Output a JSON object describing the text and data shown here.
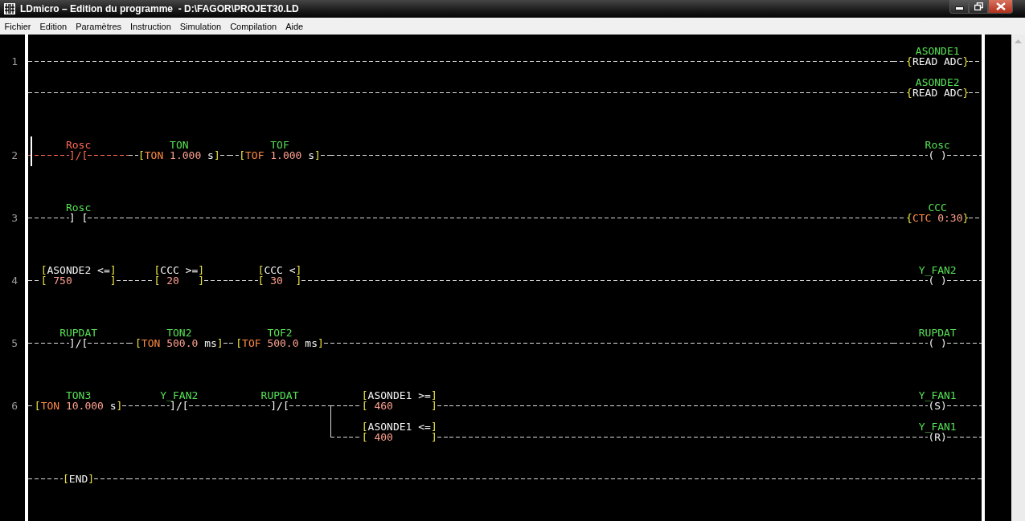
{
  "window": {
    "title": "LDmicro – Edition du programme  - D:\\FAGOR\\PROJET30.LD"
  },
  "menu": [
    "Fichier",
    "Edition",
    "Paramètres",
    "Instruction",
    "Simulation",
    "Compilation",
    "Aide"
  ],
  "rungs": [
    {
      "kind": "rung",
      "number": "1",
      "cursor": false,
      "outputs": [
        {
          "coil": {
            "label": "ASONDE1",
            "parts": [
              {
                "kind": "bracket",
                "text": "{"
              },
              {
                "kind": "plain",
                "text": "READ ADC"
              },
              {
                "kind": "bracket",
                "text": "}"
              }
            ]
          }
        },
        {
          "coil": {
            "label": "ASONDE2",
            "parts": [
              {
                "kind": "bracket",
                "text": "{"
              },
              {
                "kind": "plain",
                "text": "READ ADC"
              },
              {
                "kind": "bracket",
                "text": "}"
              }
            ]
          }
        }
      ]
    },
    {
      "kind": "rung",
      "number": "2",
      "cursor": true,
      "series": [
        {
          "kind": "contact",
          "label": "Rosc",
          "selected": true,
          "parts": [
            {
              "kind": "plain",
              "text": "]/["
            }
          ]
        },
        {
          "kind": "timer",
          "label": "TON",
          "selected": false,
          "parts": [
            {
              "kind": "bracket",
              "text": "["
            },
            {
              "kind": "op",
              "text": "TON"
            },
            {
              "kind": "value",
              "text": " 1.000"
            },
            {
              "kind": "plain",
              "text": " s"
            },
            {
              "kind": "bracket",
              "text": "]"
            }
          ]
        },
        {
          "kind": "timer",
          "label": "TOF",
          "selected": false,
          "parts": [
            {
              "kind": "bracket",
              "text": "["
            },
            {
              "kind": "op",
              "text": "TOF"
            },
            {
              "kind": "value",
              "text": " 1.000"
            },
            {
              "kind": "plain",
              "text": " s"
            },
            {
              "kind": "bracket",
              "text": "]"
            }
          ]
        }
      ],
      "outputs": [
        {
          "coil": {
            "label": "Rosc",
            "parts": [
              {
                "kind": "plain",
                "text": "( )"
              }
            ]
          }
        }
      ]
    },
    {
      "kind": "rung",
      "number": "3",
      "cursor": false,
      "series": [
        {
          "kind": "contact",
          "label": "Rosc",
          "selected": false,
          "parts": [
            {
              "kind": "plain",
              "text": "] ["
            }
          ]
        }
      ],
      "outputs": [
        {
          "coil": {
            "label": "CCC",
            "parts": [
              {
                "kind": "bracket",
                "text": "{"
              },
              {
                "kind": "op",
                "text": "CTC"
              },
              {
                "kind": "value",
                "text": " 0:30"
              },
              {
                "kind": "bracket",
                "text": "}"
              }
            ]
          }
        }
      ]
    },
    {
      "kind": "rung",
      "number": "4",
      "cursor": false,
      "series": [
        {
          "kind": "compare",
          "selected": false,
          "top": [
            {
              "kind": "bracket",
              "text": "["
            },
            {
              "kind": "plain",
              "text": "ASONDE2 <="
            },
            {
              "kind": "bracket",
              "text": "]"
            }
          ],
          "parts": [
            {
              "kind": "bracket",
              "text": "["
            },
            {
              "kind": "value",
              "text": " 750      "
            },
            {
              "kind": "bracket",
              "text": "]"
            }
          ]
        },
        {
          "kind": "compare",
          "selected": false,
          "top": [
            {
              "kind": "bracket",
              "text": "["
            },
            {
              "kind": "plain",
              "text": "CCC >="
            },
            {
              "kind": "bracket",
              "text": "]"
            }
          ],
          "parts": [
            {
              "kind": "bracket",
              "text": "["
            },
            {
              "kind": "value",
              "text": " 20   "
            },
            {
              "kind": "bracket",
              "text": "]"
            }
          ]
        },
        {
          "kind": "compare",
          "selected": false,
          "top": [
            {
              "kind": "bracket",
              "text": "["
            },
            {
              "kind": "plain",
              "text": "CCC <"
            },
            {
              "kind": "bracket",
              "text": "]"
            }
          ],
          "parts": [
            {
              "kind": "bracket",
              "text": "["
            },
            {
              "kind": "value",
              "text": " 30  "
            },
            {
              "kind": "bracket",
              "text": "]"
            }
          ]
        }
      ],
      "outputs": [
        {
          "coil": {
            "label": "Y_FAN2",
            "parts": [
              {
                "kind": "plain",
                "text": "( )"
              }
            ]
          }
        }
      ]
    },
    {
      "kind": "rung",
      "number": "5",
      "cursor": false,
      "series": [
        {
          "kind": "contact",
          "label": "RUPDAT",
          "selected": false,
          "parts": [
            {
              "kind": "plain",
              "text": "]/["
            }
          ]
        },
        {
          "kind": "timer",
          "label": "TON2",
          "selected": false,
          "parts": [
            {
              "kind": "bracket",
              "text": "["
            },
            {
              "kind": "op",
              "text": "TON"
            },
            {
              "kind": "value",
              "text": " 500.0"
            },
            {
              "kind": "plain",
              "text": " ms"
            },
            {
              "kind": "bracket",
              "text": "]"
            }
          ]
        },
        {
          "kind": "timer",
          "label": "TOF2",
          "selected": false,
          "parts": [
            {
              "kind": "bracket",
              "text": "["
            },
            {
              "kind": "op",
              "text": "TOF"
            },
            {
              "kind": "value",
              "text": " 500.0"
            },
            {
              "kind": "plain",
              "text": " ms"
            },
            {
              "kind": "bracket",
              "text": "]"
            }
          ]
        }
      ],
      "outputs": [
        {
          "coil": {
            "label": "RUPDAT",
            "parts": [
              {
                "kind": "plain",
                "text": "( )"
              }
            ]
          }
        }
      ]
    },
    {
      "kind": "rung",
      "number": "6",
      "cursor": false,
      "series": [
        {
          "kind": "timer",
          "label": "TON3",
          "selected": false,
          "parts": [
            {
              "kind": "bracket",
              "text": "["
            },
            {
              "kind": "op",
              "text": "TON"
            },
            {
              "kind": "value",
              "text": " 10.000"
            },
            {
              "kind": "plain",
              "text": " s"
            },
            {
              "kind": "bracket",
              "text": "]"
            }
          ]
        },
        {
          "kind": "contact",
          "label": "Y_FAN2",
          "selected": false,
          "parts": [
            {
              "kind": "plain",
              "text": "]/["
            }
          ]
        },
        {
          "kind": "contact",
          "label": "RUPDAT",
          "selected": false,
          "parts": [
            {
              "kind": "plain",
              "text": "]/["
            }
          ]
        }
      ],
      "outputs": [
        {
          "elements": [
            {
              "kind": "compare",
              "selected": false,
              "top": [
                {
                  "kind": "bracket",
                  "text": "["
                },
                {
                  "kind": "plain",
                  "text": "ASONDE1 >="
                },
                {
                  "kind": "bracket",
                  "text": "]"
                }
              ],
              "parts": [
                {
                  "kind": "bracket",
                  "text": "["
                },
                {
                  "kind": "value",
                  "text": " 460      "
                },
                {
                  "kind": "bracket",
                  "text": "]"
                }
              ]
            }
          ],
          "coil": {
            "label": "Y_FAN1",
            "parts": [
              {
                "kind": "plain",
                "text": "(S)"
              }
            ]
          }
        },
        {
          "elements": [
            {
              "kind": "compare",
              "selected": false,
              "top": [
                {
                  "kind": "bracket",
                  "text": "["
                },
                {
                  "kind": "plain",
                  "text": "ASONDE1 <="
                },
                {
                  "kind": "bracket",
                  "text": "]"
                }
              ],
              "parts": [
                {
                  "kind": "bracket",
                  "text": "["
                },
                {
                  "kind": "value",
                  "text": " 400      "
                },
                {
                  "kind": "bracket",
                  "text": "]"
                }
              ]
            }
          ],
          "coil": {
            "label": "Y_FAN1",
            "parts": [
              {
                "kind": "plain",
                "text": "(R)"
              }
            ]
          }
        }
      ]
    },
    {
      "kind": "end",
      "parts": [
        {
          "kind": "bracket",
          "text": "["
        },
        {
          "kind": "plain",
          "text": "END"
        },
        {
          "kind": "bracket",
          "text": "]"
        }
      ]
    }
  ]
}
